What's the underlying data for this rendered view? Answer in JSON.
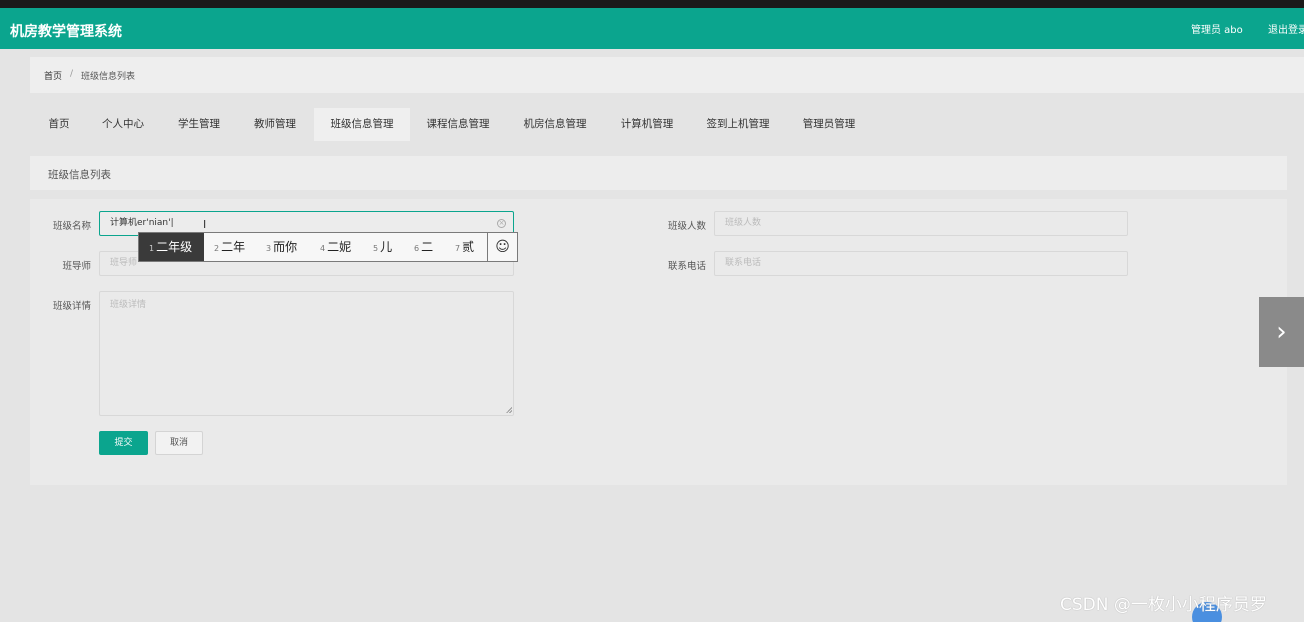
{
  "header": {
    "app_title": "机房教学管理系统",
    "admin_name": "管理员 abo",
    "logout_label": "退出登录"
  },
  "breadcrumb": {
    "home": "首页",
    "separator": "/",
    "current": "班级信息列表"
  },
  "nav": {
    "items": [
      {
        "label": "首页"
      },
      {
        "label": "个人中心"
      },
      {
        "label": "学生管理"
      },
      {
        "label": "教师管理"
      },
      {
        "label": "班级信息管理",
        "active": true
      },
      {
        "label": "课程信息管理"
      },
      {
        "label": "机房信息管理"
      },
      {
        "label": "计算机管理"
      },
      {
        "label": "签到上机管理"
      },
      {
        "label": "管理员管理"
      }
    ]
  },
  "section": {
    "title": "班级信息列表"
  },
  "form": {
    "class_name": {
      "label": "班级名称",
      "value": "计算机er'nian'|"
    },
    "class_count": {
      "label": "班级人数",
      "placeholder": "班级人数"
    },
    "teacher": {
      "label": "班导师",
      "placeholder": "班导师"
    },
    "phone": {
      "label": "联系电话",
      "placeholder": "联系电话"
    },
    "details": {
      "label": "班级详情",
      "placeholder": "班级详情"
    },
    "submit_label": "提交",
    "cancel_label": "取消"
  },
  "ime": {
    "candidates": [
      {
        "num": "1",
        "text": "二年级",
        "selected": true
      },
      {
        "num": "2",
        "text": "二年"
      },
      {
        "num": "3",
        "text": "而你"
      },
      {
        "num": "4",
        "text": "二妮"
      },
      {
        "num": "5",
        "text": "儿"
      },
      {
        "num": "6",
        "text": "二"
      },
      {
        "num": "7",
        "text": "贰"
      }
    ],
    "emoji_icon": "smiley-icon"
  },
  "watermark": "CSDN @一枚小小程序员罗",
  "colors": {
    "accent": "#0ba58e",
    "background": "#e4e4e4"
  }
}
